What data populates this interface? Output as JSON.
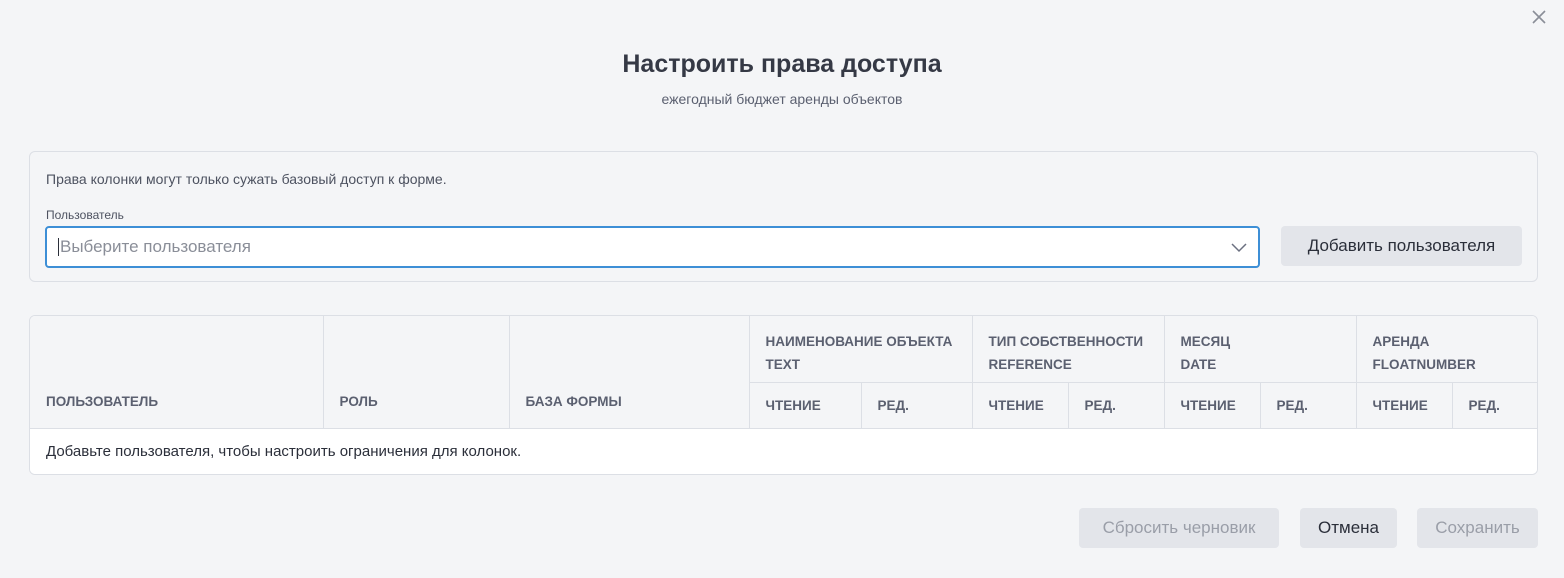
{
  "dialog": {
    "title": "Настроить права доступа",
    "subtitle": "ежегодный бюджет аренды объектов"
  },
  "user_panel": {
    "note": "Права колонки могут только сужать базовый доступ к форме.",
    "field_label": "Пользователь",
    "select_placeholder": "Выберите пользователя",
    "add_button": "Добавить пользователя"
  },
  "table": {
    "columns": {
      "user": "ПОЛЬЗОВАТЕЛЬ",
      "role": "РОЛЬ",
      "base": "БАЗА ФОРМЫ"
    },
    "field_groups": [
      {
        "name": "НАИМЕНОВАНИЕ ОБЪЕКТА",
        "type": "TEXT"
      },
      {
        "name": "ТИП СОБСТВЕННОСТИ",
        "type": "REFERENCE"
      },
      {
        "name": "МЕСЯЦ",
        "type": "DATE"
      },
      {
        "name": "АРЕНДА",
        "type": "FLOATNUMBER"
      }
    ],
    "read_label": "ЧТЕНИЕ",
    "edit_label": "РЕД.",
    "empty_message": "Добавьте пользователя, чтобы настроить ограничения для колонок."
  },
  "footer": {
    "reset_label": "Сбросить черновик",
    "cancel_label": "Отмена",
    "save_label": "Сохранить"
  },
  "icons": {
    "close": "close-icon",
    "dropdown": "chevron-down-icon"
  },
  "colors": {
    "focus_border": "#3d8fd6",
    "background": "#f4f5f7",
    "button_bg": "#e3e5ea"
  }
}
